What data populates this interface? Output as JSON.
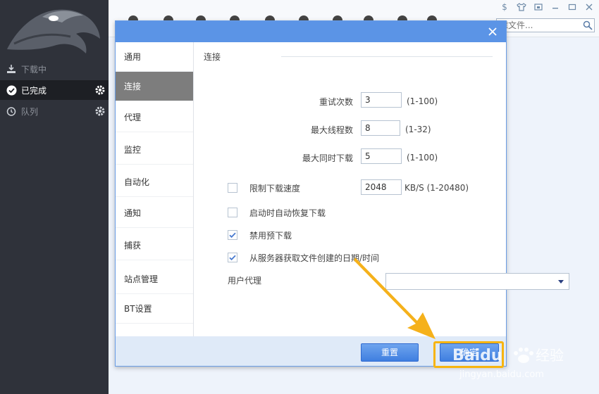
{
  "sidebar": {
    "items": [
      {
        "label": "下载中"
      },
      {
        "label": "已完成"
      },
      {
        "label": "队列"
      }
    ]
  },
  "topbar": {
    "search_placeholder": "滤文件..."
  },
  "dialog": {
    "nav": [
      {
        "label": "通用"
      },
      {
        "label": "连接"
      },
      {
        "label": "代理"
      },
      {
        "label": "监控"
      },
      {
        "label": "自动化"
      },
      {
        "label": "通知"
      },
      {
        "label": "捕获"
      },
      {
        "label": "站点管理"
      },
      {
        "label": "BT设置"
      }
    ],
    "selected_nav": "连接",
    "section_title": "连接",
    "fields": {
      "retry": {
        "label": "重试次数",
        "value": "3",
        "range": "(1-100)"
      },
      "threads": {
        "label": "最大线程数",
        "value": "8",
        "range": "(1-32)"
      },
      "simultaneous": {
        "label": "最大同时下载",
        "value": "5",
        "range": "(1-100)"
      },
      "speed_limit": {
        "label": "限制下载速度",
        "value": "2048",
        "range": "KB/S (1-20480)",
        "checked": false
      }
    },
    "checkboxes": {
      "auto_resume": {
        "label": "启动时自动恢复下载",
        "checked": false
      },
      "disable_prealloc": {
        "label": "禁用预下载",
        "checked": true
      },
      "server_time": {
        "label": "从服务器获取文件创建的日期/时间",
        "checked": true
      }
    },
    "user_agent": {
      "label": "用户代理",
      "value": ""
    },
    "buttons": {
      "reset": "重置",
      "ok": "确定"
    }
  },
  "watermark": {
    "brand": "Baidu",
    "brand_suffix": "经验",
    "url": "jingyan.baidu.com"
  },
  "colors": {
    "sidebar_bg": "#2f323a",
    "dialog_titlebar": "#5b94e6",
    "highlight": "#f7b40f",
    "nav_selected": "#7d7d7d"
  }
}
